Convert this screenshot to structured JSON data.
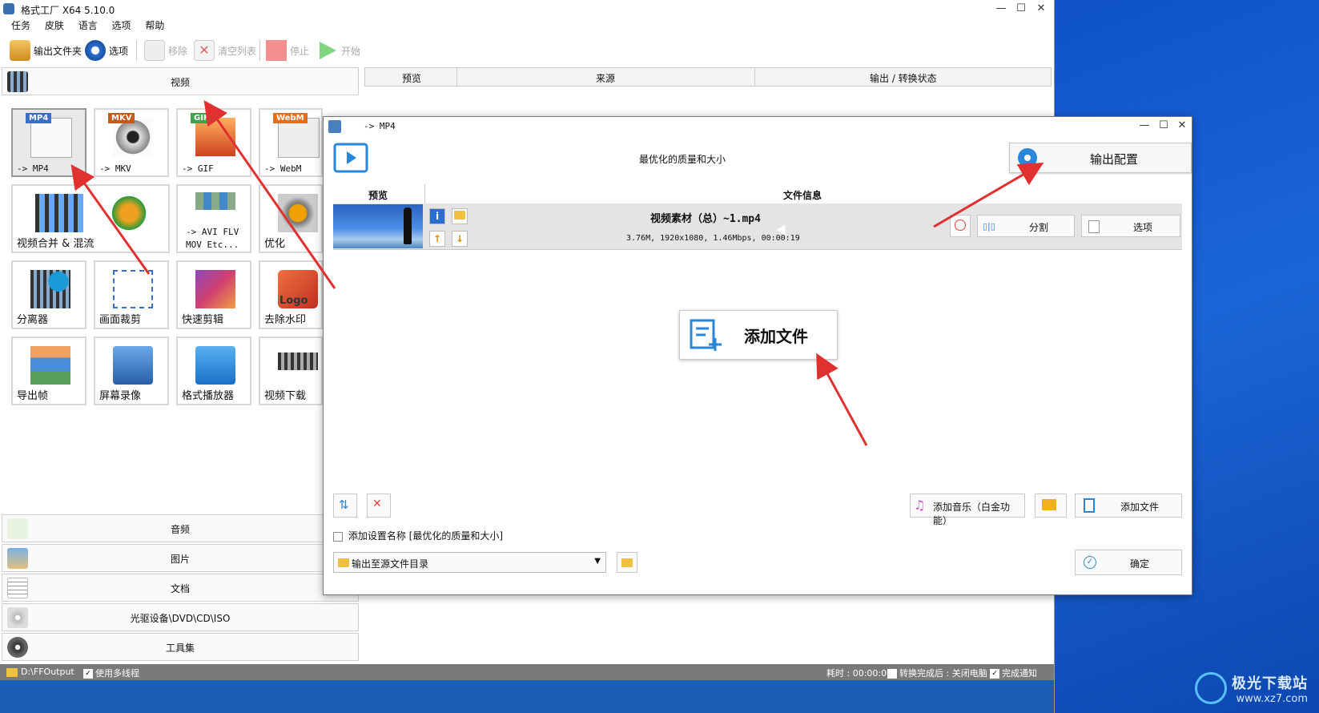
{
  "app": {
    "title": "格式工厂 X64 5.10.0"
  },
  "window_controls": {
    "minimize": "—",
    "maximize": "☐",
    "close": "✕"
  },
  "menu": [
    "任务",
    "皮肤",
    "语言",
    "选项",
    "帮助"
  ],
  "toolbar": {
    "output_folder": "输出文件夹",
    "options": "选项",
    "remove": "移除",
    "clear_list": "清空列表",
    "stop": "停止",
    "start": "开始"
  },
  "categories": {
    "video": "视频",
    "audio": "音频",
    "image": "图片",
    "document": "文档",
    "disc": "光驱设备\\DVD\\CD\\ISO",
    "tools": "工具集"
  },
  "tiles": [
    {
      "label": "-> MP4",
      "badge": "MP4",
      "icon": "mp4-icon"
    },
    {
      "label": "-> MKV",
      "badge": "MKV",
      "icon": "mkv-icon"
    },
    {
      "label": "-> GIF",
      "badge": "GIF",
      "icon": "gif-icon"
    },
    {
      "label": "-> WebM",
      "badge": "WebM",
      "icon": "webm-icon"
    },
    {
      "label": "视频合并 & 混流",
      "icon": "merge-icon"
    },
    {
      "label": "-> AVI FLV",
      "label2": "MOV Etc...",
      "icon": "formats-icon"
    },
    {
      "label": "优化",
      "icon": "optimize-icon"
    },
    {
      "label": "分离器",
      "icon": "splitter-icon"
    },
    {
      "label": "画面裁剪",
      "icon": "crop-icon"
    },
    {
      "label": "快速剪辑",
      "icon": "quick-cut-icon"
    },
    {
      "label": "去除水印",
      "badge": "Logo",
      "icon": "remove-watermark-icon"
    },
    {
      "label": "导出帧",
      "icon": "export-frames-icon"
    },
    {
      "label": "屏幕录像",
      "icon": "screen-record-icon"
    },
    {
      "label": "格式播放器",
      "icon": "player-icon"
    },
    {
      "label": "视频下载",
      "icon": "download-icon"
    }
  ],
  "task_table": {
    "preview": "预览",
    "source": "来源",
    "status": "输出 / 转换状态"
  },
  "statusbar": {
    "output_path": "D:\\FFOutput",
    "multithread": "使用多线程",
    "elapsed": "耗时 : 00:00:00",
    "after_convert": "转换完成后 : 关闭电脑",
    "notify": "完成通知"
  },
  "dialog": {
    "title": "-> MP4",
    "quality": "最优化的质量和大小",
    "output_config": "输出配置",
    "col_preview": "预览",
    "col_fileinfo": "文件信息",
    "file": {
      "name": "视频素材（总）~1.mp4",
      "info": "3.76M, 1920x1080, 1.46Mbps, 00:00:19"
    },
    "split": "分割",
    "options": "选项",
    "add_file_big": "添加文件",
    "add_music": "添加音乐（白金功能）",
    "add_file": "添加文件",
    "add_setting_name": "添加设置名称 [最优化的质量和大小]",
    "output_dir": "输出至源文件目录",
    "ok": "确定"
  },
  "watermark": {
    "title": "极光下载站",
    "url": "www.xz7.com"
  },
  "colors": {
    "accent": "#2a86d8",
    "arrow": "#e03030",
    "desktop": "#1a5fb4"
  }
}
